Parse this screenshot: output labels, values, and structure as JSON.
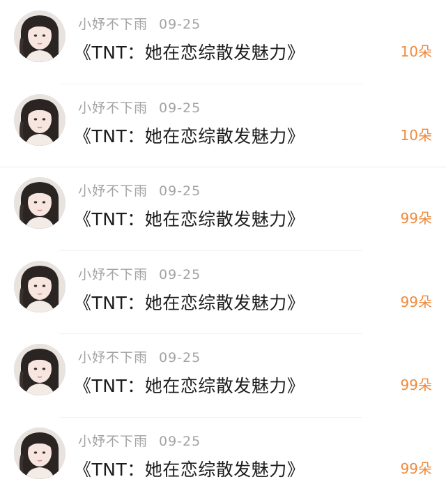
{
  "comments": [
    {
      "username": "小妤不下雨",
      "date": "09-25",
      "text": "《TNT：她在恋综散发魅力》",
      "gift": "10朵"
    },
    {
      "username": "小妤不下雨",
      "date": "09-25",
      "text": "《TNT：她在恋综散发魅力》",
      "gift": "10朵"
    },
    {
      "username": "小妤不下雨",
      "date": "09-25",
      "text": "《TNT：她在恋综散发魅力》",
      "gift": "99朵"
    },
    {
      "username": "小妤不下雨",
      "date": "09-25",
      "text": "《TNT：她在恋综散发魅力》",
      "gift": "99朵"
    },
    {
      "username": "小妤不下雨",
      "date": "09-25",
      "text": "《TNT：她在恋综散发魅力》",
      "gift": "99朵"
    },
    {
      "username": "小妤不下雨",
      "date": "09-25",
      "text": "《TNT：她在恋综散发魅力》",
      "gift": "99朵"
    }
  ],
  "colors": {
    "gift": "#ef8a3c",
    "username": "#a3a3a3",
    "text": "#1c1c1c"
  },
  "icons": {
    "avatar": "user-avatar-photo"
  }
}
